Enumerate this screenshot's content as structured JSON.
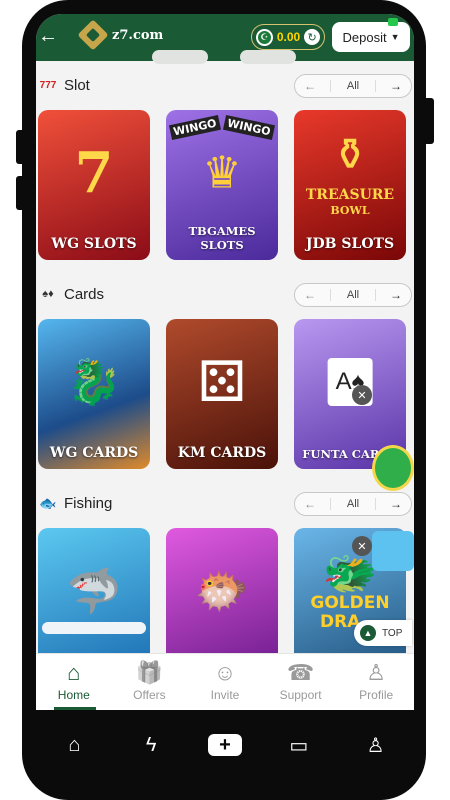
{
  "header": {
    "back_icon": "←",
    "brand": "z7.com",
    "flag_icon": "☪",
    "balance": "0.00",
    "refresh_icon": "↻",
    "deposit_label": "Deposit",
    "deposit_caret": "▼"
  },
  "sections": [
    {
      "title": "Slot",
      "icon": "777",
      "pager": {
        "prev": "←",
        "all": "All",
        "next": "→"
      },
      "cards": [
        {
          "label": "WG SLOTS",
          "art": "7",
          "colors": [
            "#e0303a",
            "#8b0c17"
          ]
        },
        {
          "label": "TBGAMES SLOTS",
          "art": "♛",
          "banner_left": "WINGO",
          "banner_right": "WINGO",
          "colors": [
            "#8a5bd6",
            "#4b2a9b"
          ]
        },
        {
          "label": "JDB SLOTS",
          "art": "⚱",
          "subtitle_line1": "TREASURE",
          "subtitle_line2": "BOWL",
          "colors": [
            "#e0261b",
            "#7a0707"
          ]
        }
      ]
    },
    {
      "title": "Cards",
      "icon": "♠♦",
      "pager": {
        "prev": "←",
        "all": "All",
        "next": "→"
      },
      "cards": [
        {
          "label": "WG CARDS",
          "art": "🐉",
          "colors": [
            "#3a9ae0",
            "#1d4c8a"
          ]
        },
        {
          "label": "KM CARDS",
          "art": "⚄",
          "colors": [
            "#9a3a22",
            "#4a1209"
          ]
        },
        {
          "label": "FUNTA CARDS",
          "art": "A♠",
          "colors": [
            "#a27ce6",
            "#5a34a8"
          ]
        }
      ]
    },
    {
      "title": "Fishing",
      "icon": "🐟",
      "pager": {
        "prev": "←",
        "all": "All",
        "next": "→"
      },
      "cards": [
        {
          "label": "",
          "art": "🦈",
          "colors": [
            "#3fb8e8",
            "#1a6bb0"
          ]
        },
        {
          "label": "",
          "art": "🐡",
          "colors": [
            "#d63ad6",
            "#6a1a8a"
          ]
        },
        {
          "label": "",
          "art": "🐲",
          "subtitle_line1": "GOLDEN",
          "subtitle_line2": "DRA...",
          "colors": [
            "#4aa0d8",
            "#1e4f7a"
          ]
        }
      ]
    }
  ],
  "floating": {
    "close_icon": "✕",
    "top_label": "TOP",
    "top_icon": "▲"
  },
  "bottom_nav": [
    {
      "label": "Home",
      "icon": "⌂",
      "active": true
    },
    {
      "label": "Offers",
      "icon": "🎁",
      "active": false
    },
    {
      "label": "Invite",
      "icon": "☺",
      "active": false
    },
    {
      "label": "Support",
      "icon": "☎",
      "active": false
    },
    {
      "label": "Profile",
      "icon": "♙",
      "active": false
    }
  ],
  "system_bar": {
    "home_icon": "⌂",
    "flash_icon": "ϟ",
    "plus_icon": "+",
    "chat_icon": "▭",
    "person_icon": "♙"
  },
  "colors": {
    "brand_green": "#1a5b35",
    "balance_yellow": "#ffd400"
  }
}
